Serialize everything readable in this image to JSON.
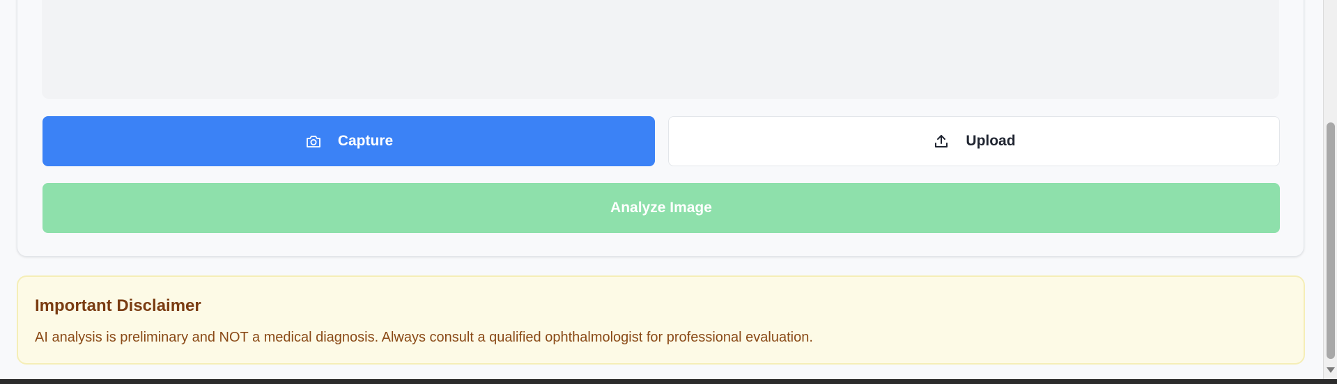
{
  "actions": {
    "capture_label": "Capture",
    "upload_label": "Upload",
    "analyze_label": "Analyze Image"
  },
  "disclaimer": {
    "title": "Important Disclaimer",
    "text": "AI analysis is preliminary and NOT a medical diagnosis. Always consult a qualified ophthalmologist for professional evaluation."
  },
  "icons": {
    "capture": "camera-icon",
    "upload": "upload-icon"
  },
  "colors": {
    "capture_button": "#3b82f6",
    "analyze_button_disabled": "#8ee0ab",
    "disclaimer_bg": "#fdfae6",
    "disclaimer_title": "#7a3c12"
  }
}
